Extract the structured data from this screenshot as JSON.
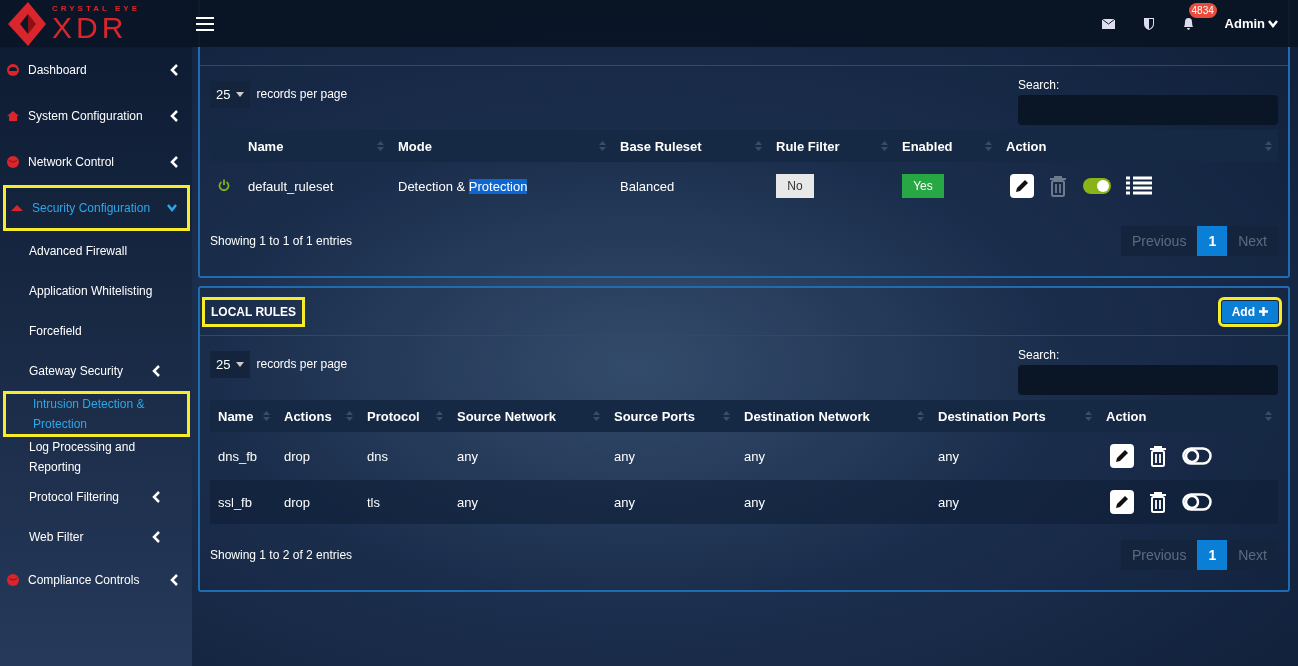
{
  "logo": {
    "tagline": "CRYSTAL EYE",
    "name": "XDR"
  },
  "header": {
    "notification_count": "4834",
    "user": "Admin"
  },
  "sidebar": {
    "items": [
      {
        "label": "Dashboard",
        "kind": "gauge",
        "selected": false,
        "expanded": false,
        "highlighted": false
      },
      {
        "label": "System Configuration",
        "kind": "house",
        "selected": false,
        "expanded": false,
        "highlighted": false
      },
      {
        "label": "Network Control",
        "kind": "globe",
        "selected": false,
        "expanded": false,
        "highlighted": false
      },
      {
        "label": "Security Configuration",
        "kind": "shield",
        "selected": true,
        "expanded": true,
        "highlighted": true,
        "children": [
          {
            "label": "Advanced Firewall",
            "selected": false,
            "has_submenu": false,
            "highlighted": false
          },
          {
            "label": "Application Whitelisting",
            "selected": false,
            "has_submenu": false,
            "highlighted": false
          },
          {
            "label": "Forcefield",
            "selected": false,
            "has_submenu": false,
            "highlighted": false
          },
          {
            "label": "Gateway Security",
            "selected": false,
            "has_submenu": true,
            "highlighted": false
          },
          {
            "label": "Intrusion Detection & Protection",
            "selected": true,
            "has_submenu": false,
            "highlighted": true
          },
          {
            "label": "Log Processing and Reporting",
            "selected": false,
            "has_submenu": false,
            "highlighted": false
          },
          {
            "label": "Protocol Filtering",
            "selected": false,
            "has_submenu": true,
            "highlighted": false
          },
          {
            "label": "Web Filter",
            "selected": false,
            "has_submenu": true,
            "highlighted": false
          }
        ]
      },
      {
        "label": "Compliance Controls",
        "kind": "globe",
        "selected": false,
        "expanded": false,
        "highlighted": false
      }
    ]
  },
  "rulesets": {
    "page_size": "25",
    "page_size_label": "records per page",
    "search_label": "Search:",
    "columns": [
      "",
      "Name",
      "Mode",
      "Base Ruleset",
      "Rule Filter",
      "Enabled",
      "Action"
    ],
    "rows": [
      {
        "active": true,
        "name": "default_ruleset",
        "mode": "Detection &",
        "mode_selection": "Protection",
        "base": "Balanced",
        "rule_filter": "No",
        "rule_filter_on": false,
        "enabled": "Yes",
        "enabled_on": true,
        "toggle_on": true
      }
    ],
    "summary": "Showing 1 to 1 of 1 entries",
    "pagination": [
      {
        "label": "Previous",
        "selected": false,
        "disabled": true
      },
      {
        "label": "1",
        "selected": true,
        "disabled": false
      },
      {
        "label": "Next",
        "selected": false,
        "disabled": true
      }
    ]
  },
  "local_rules": {
    "title": "LOCAL RULES",
    "highlighted": true,
    "add_button": "Add",
    "add_highlighted": true,
    "page_size": "25",
    "page_size_label": "records per page",
    "search_label": "Search:",
    "columns": [
      "Name",
      "Actions",
      "Protocol",
      "Source Network",
      "Source Ports",
      "Destination Network",
      "Destination Ports",
      "Action"
    ],
    "rows": [
      {
        "cells": [
          "dns_fb",
          "drop",
          "dns",
          "any",
          "any",
          "any",
          "any"
        ],
        "toggle_on": false
      },
      {
        "cells": [
          "ssl_fb",
          "drop",
          "tls",
          "any",
          "any",
          "any",
          "any"
        ],
        "toggle_on": false
      }
    ],
    "summary": "Showing 1 to 2 of 2 entries",
    "pagination": [
      {
        "label": "Previous",
        "selected": false,
        "disabled": true
      },
      {
        "label": "1",
        "selected": true,
        "disabled": false
      },
      {
        "label": "Next",
        "selected": false,
        "disabled": true
      }
    ]
  }
}
